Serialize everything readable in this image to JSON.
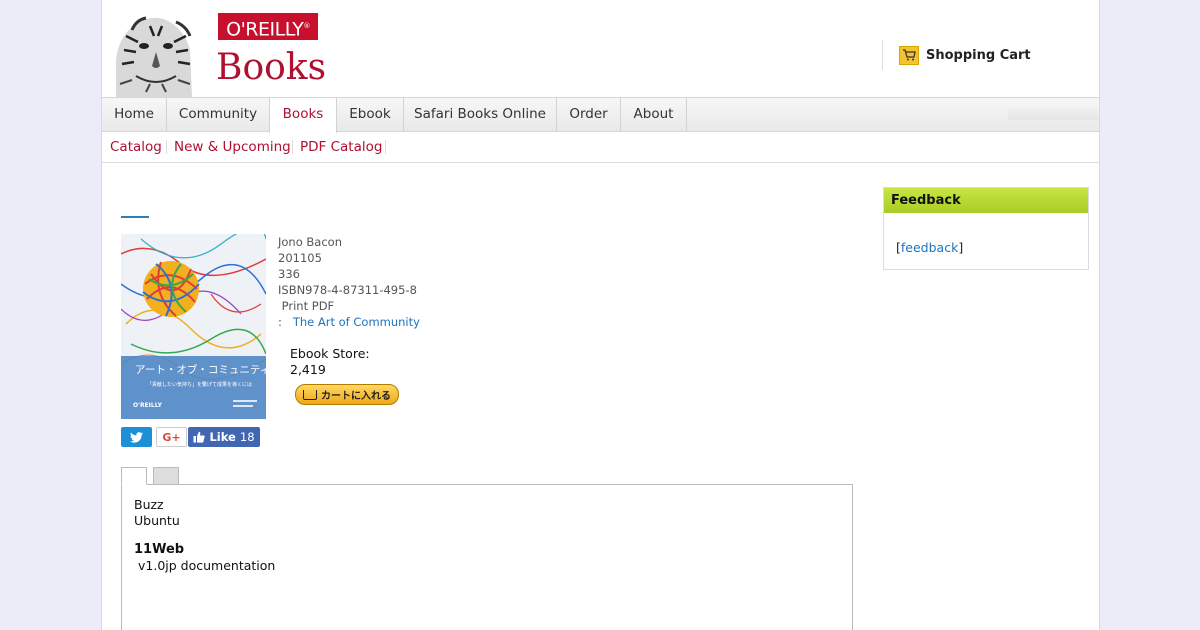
{
  "header": {
    "brand": "O'REILLY",
    "brand_reg": "®",
    "section_title": "Books",
    "cart_label": "Shopping Cart"
  },
  "nav": {
    "items": [
      "Home",
      "Community",
      "Books",
      "Ebook",
      "Safari Books Online",
      "Order",
      "About"
    ],
    "active": "Books"
  },
  "subnav": {
    "items": [
      "Catalog",
      "New & Upcoming",
      "PDF Catalog"
    ]
  },
  "book": {
    "cover_title": "アート・オブ・コミュニティ",
    "cover_subtitle": "「貢献したい気持ち」を繋げて成果を導くには",
    "cover_publisher": "O'REILLY",
    "author": "Jono Bacon",
    "date": "201105",
    "pages": "336",
    "isbn": "ISBN978-4-87311-495-8",
    "formats": " Print PDF",
    "original_prefix": ":",
    "original_title": "The Art of Community",
    "ebook_store_label": "Ebook Store:",
    "ebook_price": "2,419",
    "add_to_cart_label": "カートに入れる"
  },
  "social": {
    "twitter": "t",
    "gplus": "G+",
    "fb_like": "Like",
    "fb_count": "18"
  },
  "tab_content": {
    "line1": "Buzz",
    "line2": "Ubuntu",
    "heading": "11Web",
    "link": "v1.0jp documentation"
  },
  "sidebar": {
    "title": "Feedback",
    "bracket_open": "[",
    "link": "feedback",
    "bracket_close": "]"
  },
  "colors": {
    "brand_red": "#c8102e",
    "link_blue": "#1e73be",
    "feedback_green": "#b8da34"
  }
}
